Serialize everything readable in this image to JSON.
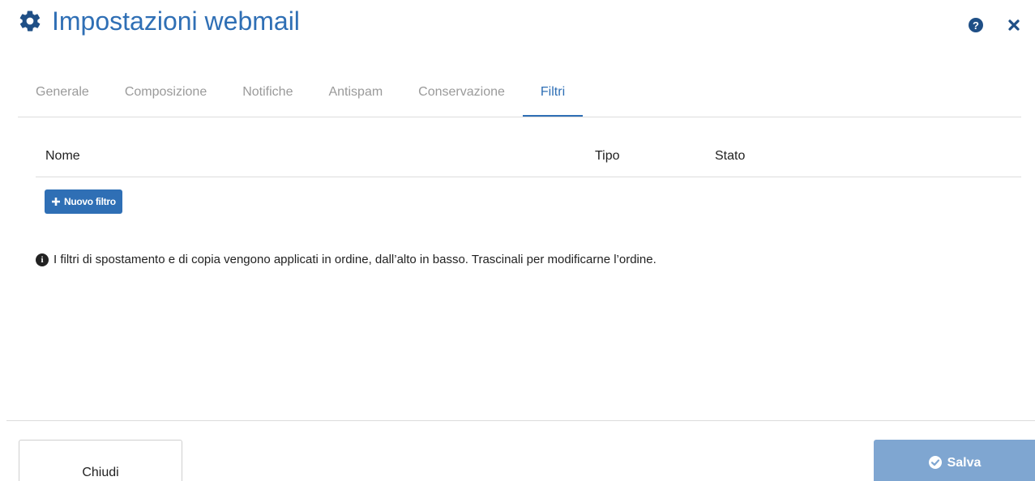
{
  "dialog": {
    "title": "Impostazioni webmail",
    "icons": {
      "title_icon": "gear-icon",
      "help": "question-circle-icon",
      "close": "close-icon"
    },
    "help_glyph": "?",
    "accent_color": "#2f6fb5"
  },
  "tabs": [
    {
      "label": "Generale",
      "active": false
    },
    {
      "label": "Composizione",
      "active": false
    },
    {
      "label": "Notifiche",
      "active": false
    },
    {
      "label": "Antispam",
      "active": false
    },
    {
      "label": "Conservazione",
      "active": false
    },
    {
      "label": "Filtri",
      "active": true
    }
  ],
  "filters_table": {
    "columns": {
      "name": "Nome",
      "type": "Tipo",
      "state": "Stato"
    },
    "rows": []
  },
  "add_filter_button": {
    "label": "Nuovo filtro",
    "icon": "plus-icon"
  },
  "info": {
    "icon": "info-circle-icon",
    "glyph": "i",
    "text": "I filtri di spostamento e di copia vengono applicati in ordine, dall’alto in basso. Trascinali per modificarne l’ordine."
  },
  "footer": {
    "close_label": "Chiudi",
    "save_label": "Salva",
    "save_icon": "check-circle-icon",
    "save_color": "#7fa6d1"
  }
}
